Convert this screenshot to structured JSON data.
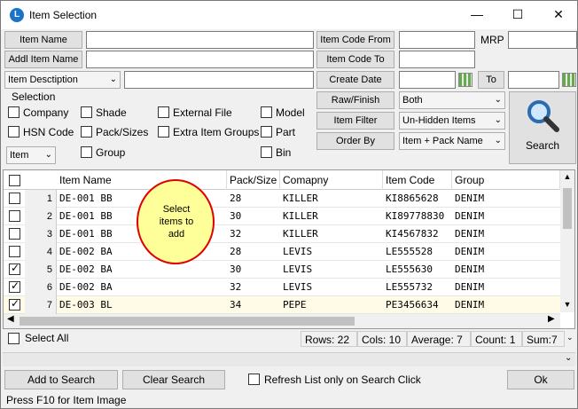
{
  "window": {
    "title": "Item Selection",
    "minimize": "—",
    "maximize": "☐",
    "close": "✕"
  },
  "filters": {
    "item_name_label": "Item Name",
    "addl_item_name_label": "Addl Item Name",
    "item_description_combo": "Item Desctiption",
    "item_code_from_label": "Item Code From",
    "item_code_to_label": "Item Code To",
    "create_date_label": "Create Date",
    "to_label": "To",
    "mrp_label": "MRP",
    "raw_finish_label": "Raw/Finish",
    "raw_finish_value": "Both",
    "item_filter_label": "Item Filter",
    "item_filter_value": "Un-Hidden Items",
    "order_by_label": "Order By",
    "order_by_value": "Item + Pack  Name",
    "search_label": "Search"
  },
  "selection": {
    "title": "Selection",
    "company": "Company",
    "shade": "Shade",
    "external_file": "External File",
    "model": "Model",
    "hsn_code": "HSN Code",
    "pack_sizes": "Pack/Sizes",
    "extra_item_groups": "Extra Item Groups",
    "part": "Part",
    "item_combo": "Item",
    "group": "Group",
    "bin": "Bin"
  },
  "grid": {
    "columns": [
      "Item Name",
      "Pack/Size",
      "Comapny",
      "Item Code",
      "Group"
    ],
    "rows": [
      {
        "n": "1",
        "checked": false,
        "item": "DE-001 BB",
        "pack": "28",
        "company": "KILLER",
        "code": "KI8865628",
        "group": "DENIM"
      },
      {
        "n": "2",
        "checked": false,
        "item": "DE-001 BB",
        "pack": "30",
        "company": "KILLER",
        "code": "KI89778830",
        "group": "DENIM"
      },
      {
        "n": "3",
        "checked": false,
        "item": "DE-001 BB",
        "pack": "32",
        "company": "KILLER",
        "code": "KI4567832",
        "group": "DENIM"
      },
      {
        "n": "4",
        "checked": false,
        "item": "DE-002 BA",
        "pack": "28",
        "company": "LEVIS",
        "code": "LE555528",
        "group": "DENIM"
      },
      {
        "n": "5",
        "checked": true,
        "item": "DE-002 BA",
        "pack": "30",
        "company": "LEVIS",
        "code": "LE555630",
        "group": "DENIM"
      },
      {
        "n": "6",
        "checked": true,
        "item": "DE-002 BA",
        "pack": "32",
        "company": "LEVIS",
        "code": "LE555732",
        "group": "DENIM"
      },
      {
        "n": "7",
        "checked": true,
        "item": "DE-003 BL",
        "pack": "34",
        "company": "PEPE",
        "code": "PE3456634",
        "group": "DENIM"
      }
    ],
    "annotation": "Select items to add"
  },
  "status": {
    "select_all": "Select All",
    "rows": "Rows: 22",
    "cols": "Cols: 10",
    "average": "Average: 7",
    "count": "Count: 1",
    "sum": "Sum:7"
  },
  "buttons": {
    "add_to_search": "Add to Search",
    "clear_search": "Clear Search",
    "refresh_label": "Refresh List only on Search Click",
    "ok": "Ok"
  },
  "footer": {
    "hint": "Press F10 for Item Image"
  }
}
